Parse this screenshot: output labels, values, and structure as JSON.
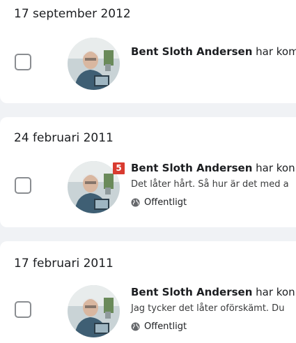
{
  "colors": {
    "page_background": "#f0f2f5",
    "card_background": "#ffffff",
    "text": "#1c1e21",
    "badge": "#d93b30",
    "checkbox_border": "#8a8d91"
  },
  "entries": [
    {
      "date": "17 september 2012",
      "author": "Bent Sloth Andersen",
      "action": " har kom",
      "snippet": "",
      "privacy": "",
      "checked": false
    },
    {
      "date": "24 februari 2011",
      "badge": "5",
      "author": "Bent Sloth Andersen",
      "action": " har kon",
      "snippet": "Det låter hårt. Så hur är det med a",
      "privacy": "Offentligt",
      "privacy_icon": "globe-icon",
      "checked": false
    },
    {
      "date": "17 februari 2011",
      "author": "Bent Sloth Andersen",
      "action": " har kon",
      "snippet": "Jag tycker det låter oförskämt. Du",
      "privacy": "Offentligt",
      "privacy_icon": "globe-icon",
      "checked": false
    }
  ]
}
